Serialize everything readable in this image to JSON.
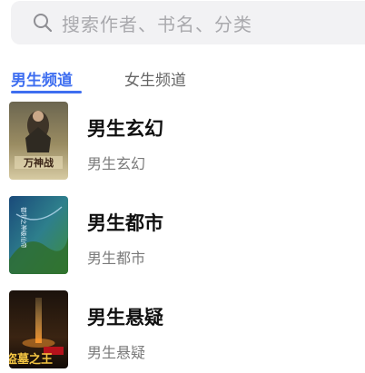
{
  "search": {
    "placeholder": "搜索作者、书名、分类",
    "icon": "search-icon"
  },
  "tabs": [
    {
      "label": "男生频道",
      "active": true
    },
    {
      "label": "女生频道",
      "active": false
    }
  ],
  "colors": {
    "accent": "#3e6ef0",
    "search_bg": "#f2f2f4",
    "placeholder": "#a9a9ad"
  },
  "categories": [
    {
      "title": "男生玄幻",
      "subtitle": "男生玄幻",
      "cover_text": "万神战"
    },
    {
      "title": "男生都市",
      "subtitle": "男生都市",
      "cover_text": "都市之神级仙帝"
    },
    {
      "title": "男生悬疑",
      "subtitle": "男生悬疑",
      "cover_text": "盗墓之王"
    }
  ]
}
